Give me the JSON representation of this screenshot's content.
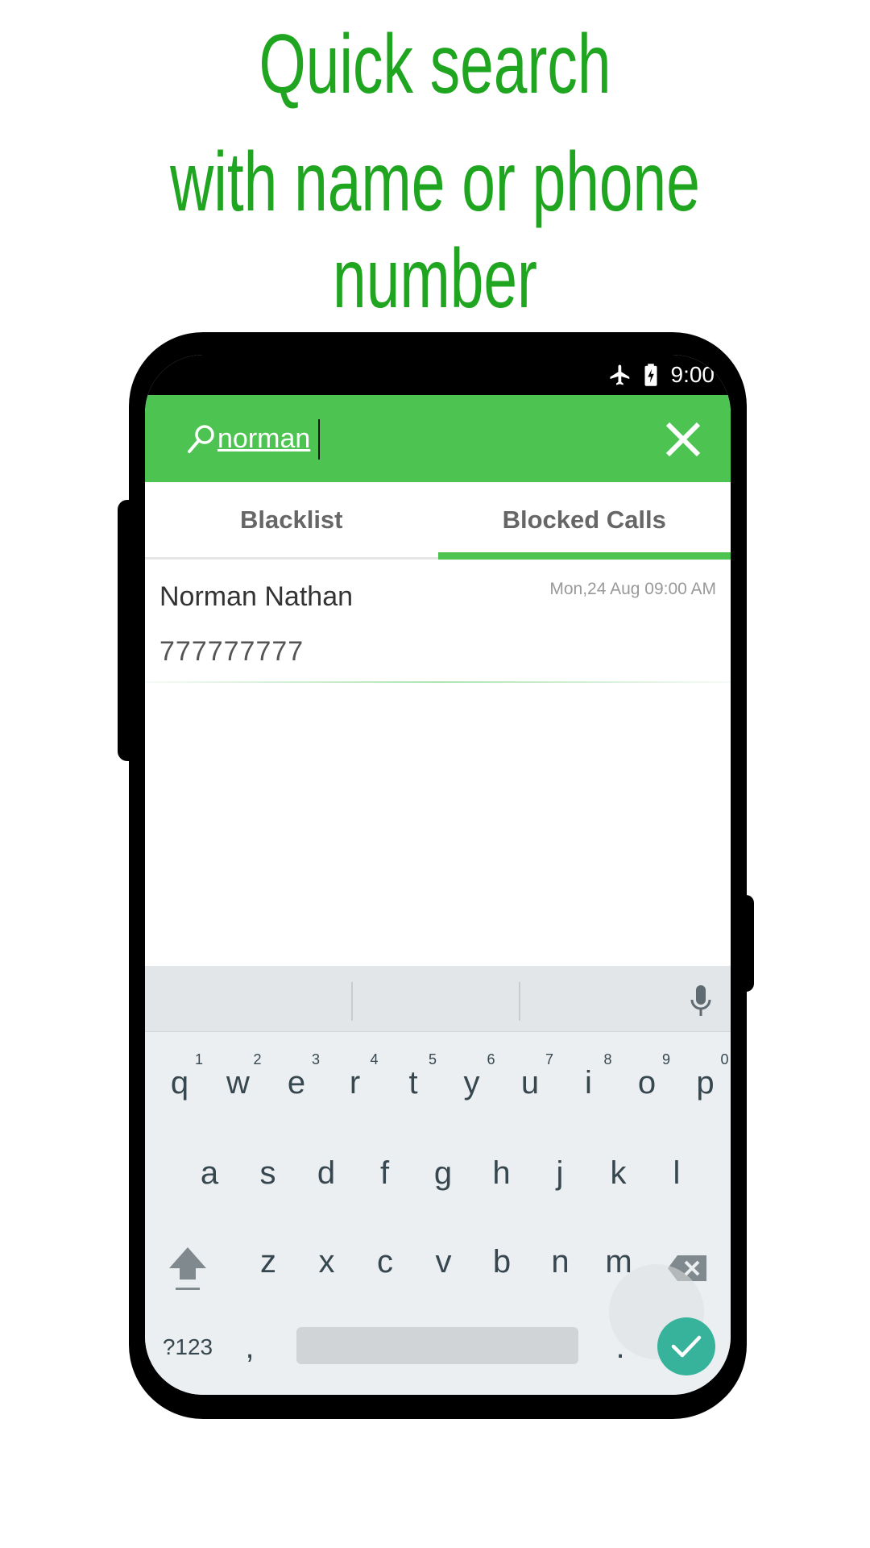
{
  "promo": {
    "line1": "Quick search",
    "line2": "with name or phone number",
    "color": "#1fa51f"
  },
  "status_bar": {
    "time": "9:00",
    "icons": [
      "airplane-mode-icon",
      "battery-charging-icon"
    ]
  },
  "search": {
    "icon": "search-icon",
    "query": "norman",
    "close_icon": "close-icon"
  },
  "tabs": [
    {
      "label": "Blacklist",
      "active": false
    },
    {
      "label": "Blocked Calls",
      "active": true
    }
  ],
  "results": [
    {
      "name": "Norman Nathan",
      "number": "777777777",
      "date": "Mon,24 Aug 09:00 AM"
    }
  ],
  "keyboard": {
    "row1": [
      {
        "key": "q",
        "hint": "1"
      },
      {
        "key": "w",
        "hint": "2"
      },
      {
        "key": "e",
        "hint": "3"
      },
      {
        "key": "r",
        "hint": "4"
      },
      {
        "key": "t",
        "hint": "5"
      },
      {
        "key": "y",
        "hint": "6"
      },
      {
        "key": "u",
        "hint": "7"
      },
      {
        "key": "i",
        "hint": "8"
      },
      {
        "key": "o",
        "hint": "9"
      },
      {
        "key": "p",
        "hint": "0"
      }
    ],
    "row2": [
      "a",
      "s",
      "d",
      "f",
      "g",
      "h",
      "j",
      "k",
      "l"
    ],
    "row3": [
      "z",
      "x",
      "c",
      "v",
      "b",
      "n",
      "m"
    ],
    "symbols_label": "?123",
    "comma": ",",
    "period": ".",
    "mic_icon": "mic-icon",
    "shift_icon": "shift-icon",
    "backspace_icon": "backspace-icon",
    "enter_icon": "check-icon"
  },
  "colors": {
    "accent": "#4dc452",
    "enter": "#37b39b",
    "keyboard_bg": "#eceff1"
  }
}
